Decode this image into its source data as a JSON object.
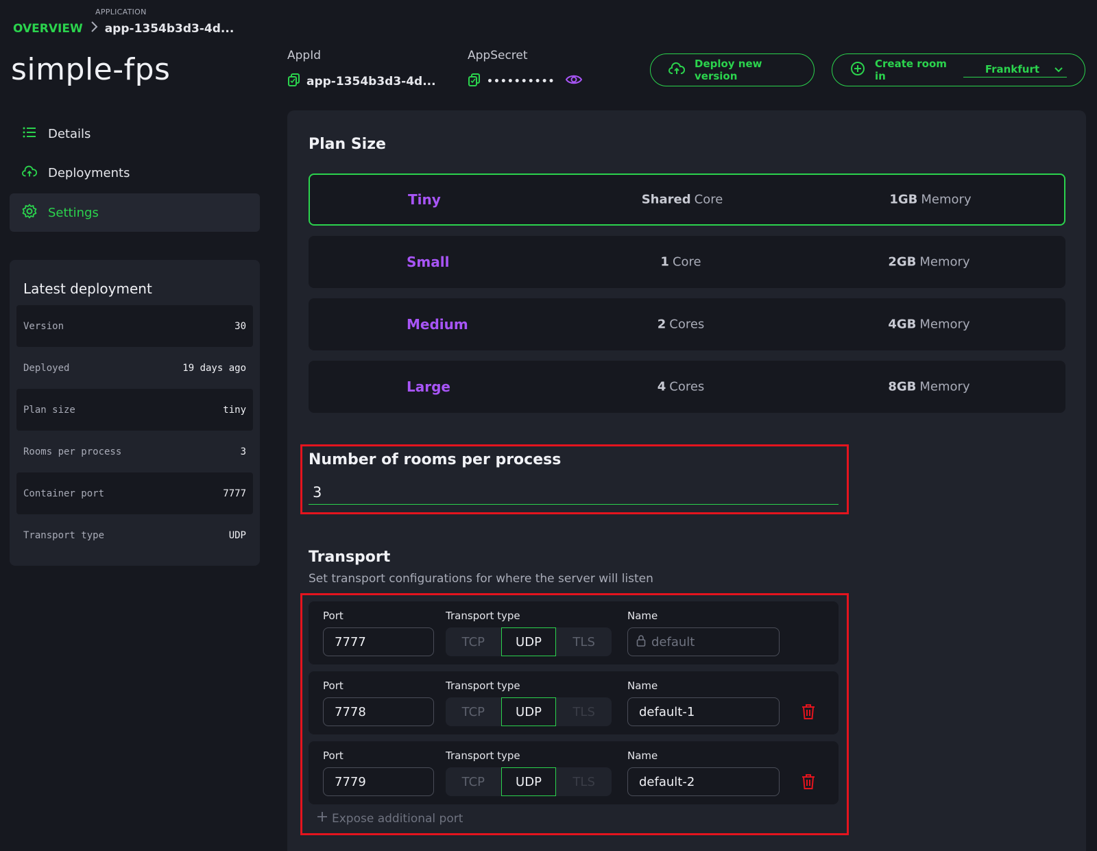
{
  "breadcrumb": {
    "section_label": "APPLICATION",
    "overview": "OVERVIEW",
    "current": "app-1354b3d3-4d..."
  },
  "app": {
    "title": "simple-fps"
  },
  "header": {
    "appid_label": "AppId",
    "appid_value": "app-1354b3d3-4d...",
    "secret_label": "AppSecret",
    "secret_value": "••••••••••",
    "deploy_button": "Deploy new version",
    "create_room_button": "Create room in",
    "region_selected": "Frankfurt"
  },
  "sidebar": {
    "items": [
      {
        "label": "Details",
        "icon": "list-icon"
      },
      {
        "label": "Deployments",
        "icon": "cloud-upload-icon"
      },
      {
        "label": "Settings",
        "icon": "gear-icon",
        "active": true
      }
    ]
  },
  "latest_deployment": {
    "title": "Latest deployment",
    "rows": [
      {
        "key": "Version",
        "value": "30"
      },
      {
        "key": "Deployed",
        "value": "19 days ago"
      },
      {
        "key": "Plan size",
        "value": "tiny"
      },
      {
        "key": "Rooms per process",
        "value": "3"
      },
      {
        "key": "Container port",
        "value": "7777"
      },
      {
        "key": "Transport type",
        "value": "UDP"
      }
    ]
  },
  "plan_size": {
    "title": "Plan Size",
    "plans": [
      {
        "name": "Tiny",
        "cpu_bold": "Shared",
        "cpu_rest": "Core",
        "mem_bold": "1GB",
        "mem_rest": "Memory",
        "selected": true
      },
      {
        "name": "Small",
        "cpu_bold": "1",
        "cpu_rest": "Core",
        "mem_bold": "2GB",
        "mem_rest": "Memory"
      },
      {
        "name": "Medium",
        "cpu_bold": "2",
        "cpu_rest": "Cores",
        "mem_bold": "4GB",
        "mem_rest": "Memory"
      },
      {
        "name": "Large",
        "cpu_bold": "4",
        "cpu_rest": "Cores",
        "mem_bold": "8GB",
        "mem_rest": "Memory"
      }
    ]
  },
  "rooms": {
    "title": "Number of rooms per process",
    "value": "3"
  },
  "transport": {
    "title": "Transport",
    "subtitle": "Set transport configurations for where the server will listen",
    "port_label": "Port",
    "type_label": "Transport type",
    "name_label": "Name",
    "options": [
      "TCP",
      "UDP",
      "TLS"
    ],
    "rows": [
      {
        "port": "7777",
        "type": "UDP",
        "name": "default",
        "name_locked": true
      },
      {
        "port": "7778",
        "type": "UDP",
        "name": "default-1"
      },
      {
        "port": "7779",
        "type": "UDP",
        "name": "default-2"
      }
    ],
    "expose_label": "Expose additional port"
  },
  "colors": {
    "accent": "#2bd34d",
    "plan_name": "#a855f7",
    "danger": "#e4141e",
    "background": "#16181f",
    "panel": "#20232c"
  }
}
